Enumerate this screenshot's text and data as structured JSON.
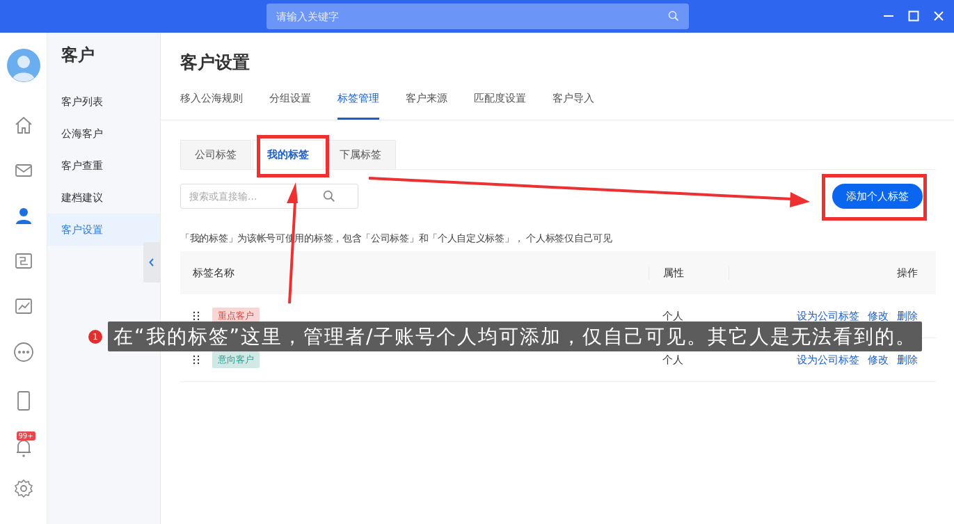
{
  "titlebar": {
    "search_placeholder": "请输入关键字"
  },
  "notifications": {
    "badge": "99+"
  },
  "sidebar": {
    "title": "客户",
    "items": [
      {
        "label": "客户列表",
        "selected": false
      },
      {
        "label": "公海客户",
        "selected": false
      },
      {
        "label": "客户查重",
        "selected": false
      },
      {
        "label": "建档建议",
        "selected": false
      },
      {
        "label": "客户设置",
        "selected": true
      }
    ]
  },
  "page": {
    "title": "客户设置",
    "tabs": [
      {
        "label": "移入公海规则",
        "selected": false
      },
      {
        "label": "分组设置",
        "selected": false
      },
      {
        "label": "标签管理",
        "selected": true
      },
      {
        "label": "客户来源",
        "selected": false
      },
      {
        "label": "匹配度设置",
        "selected": false
      },
      {
        "label": "客户导入",
        "selected": false
      }
    ],
    "subtabs": [
      {
        "label": "公司标签",
        "selected": false
      },
      {
        "label": "我的标签",
        "selected": true
      },
      {
        "label": "下属标签",
        "selected": false
      }
    ],
    "search": {
      "placeholder": "搜索或直接输..."
    },
    "add_button": "添加个人标签",
    "note": "「我的标签」为该帐号可使用的标签，包含「公司标签」和「个人自定义标签」， 个人标签仅自己可见",
    "table": {
      "columns": [
        "标签名称",
        "属性",
        "操作"
      ],
      "rows": [
        {
          "tag": "重点客户",
          "color": "#d9453f",
          "attribute": "个人",
          "actions": [
            "设为公司标签",
            "修改",
            "删除"
          ]
        },
        {
          "tag": "意向客户",
          "color": "#2a9d8f",
          "attribute": "个人",
          "actions": [
            "设为公司标签",
            "修改",
            "删除"
          ]
        }
      ]
    }
  },
  "annotation": {
    "number": "1",
    "text": "在“我的标签”这里，管理者/子账号个人均可添加，仅自己可见。其它人是无法看到的。"
  }
}
